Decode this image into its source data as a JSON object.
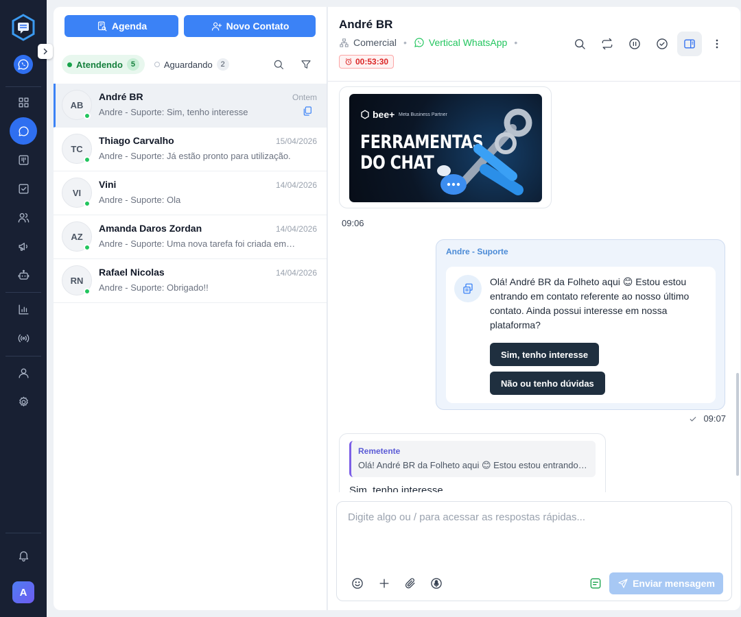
{
  "sidebar": {
    "nav_icons": [
      "dashboard-icon",
      "chat-icon",
      "kanban-icon",
      "tasks-icon",
      "contacts-icon",
      "campaigns-icon",
      "bot-icon",
      "reports-icon",
      "broadcast-icon",
      "profile-icon",
      "settings-icon",
      "bell-icon"
    ],
    "user_initial": "A",
    "active_item": "chat-icon"
  },
  "contacts_panel": {
    "agenda_label": "Agenda",
    "new_contact_label": "Novo Contato",
    "tabs": [
      {
        "label": "Atendendo",
        "count": "5"
      },
      {
        "label": "Aguardando",
        "count": "2"
      }
    ],
    "conversations": [
      {
        "initials": "AB",
        "name": "André BR",
        "date": "Ontem",
        "preview": "Andre - Suporte: Sim, tenho interesse"
      },
      {
        "initials": "TC",
        "name": "Thiago Carvalho",
        "date": "15/04/2026",
        "preview": "Andre - Suporte: Já estão pronto para utilização."
      },
      {
        "initials": "VI",
        "name": "Vini",
        "date": "14/04/2026",
        "preview": "Andre - Suporte: Ola"
      },
      {
        "initials": "AZ",
        "name": "Amanda Daros Zordan",
        "date": "14/04/2026",
        "preview": "Andre - Suporte: Uma nova tarefa foi criada em…"
      },
      {
        "initials": "RN",
        "name": "Rafael Nicolas",
        "date": "14/04/2026",
        "preview": "Andre - Suporte: Obrigado!!"
      }
    ]
  },
  "chat": {
    "contact_name": "André BR",
    "department": "Comercial",
    "channel": "Vertical WhatsApp",
    "timer": "00:53:30",
    "accent_color": "#3b82f6",
    "messages": {
      "image_brand": "bee+",
      "image_partner": "Meta Business Partner",
      "image_headline_1": "FERRAMENTAS",
      "image_headline_2": "DO CHAT",
      "image_time": "09:06",
      "sender": "Andre - Suporte",
      "template_text": "Olá! André BR da Folheto aqui 😊 Estou estou entrando em contato referente ao nosso último contato. Ainda possui interesse em nossa plataforma?",
      "quick_reply_1": "Sim, tenho interesse",
      "quick_reply_2": "Não ou tenho dúvidas",
      "out_time": "09:07",
      "quote_title": "Remetente",
      "quote_text": "Olá! André BR da Folheto aqui 😊 Estou estou entrando em contato referente ao nosso último contato.",
      "reply_text": "Sim, tenho interesse"
    },
    "composer": {
      "placeholder": "Digite algo ou / para acessar as respostas rápidas...",
      "value": "",
      "send_label": "Enviar mensagem"
    }
  }
}
